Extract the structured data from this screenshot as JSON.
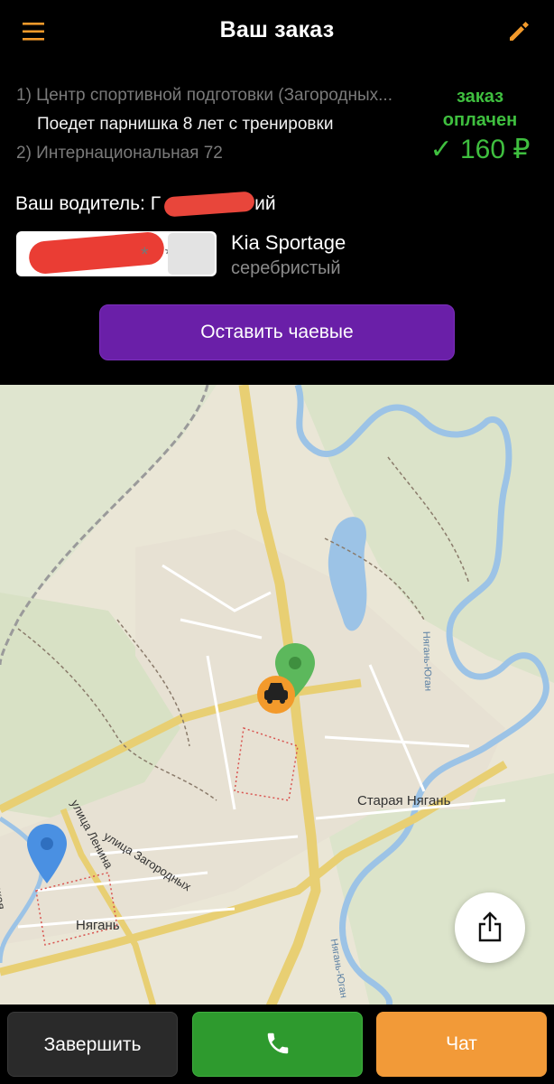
{
  "header": {
    "title": "Ваш заказ",
    "menu_icon": "menu-icon",
    "edit_icon": "pencil-icon",
    "accent_color": "#f39a2b"
  },
  "route": {
    "stop1": "1) Центр спортивной подготовки  (Загородных...",
    "note": "Поедет парнишка 8 лет с тренировки",
    "stop2": "2) Интернациональная 72"
  },
  "payment": {
    "status": "заказ оплачен",
    "price": "✓ 160 ₽",
    "color": "#3fbf3f"
  },
  "driver": {
    "label": "Ваш водитель: Г",
    "name_suffix": "ий",
    "plate_stars": "* *",
    "car_model": "Kia Sportage",
    "car_color": "серебристый"
  },
  "tip_button": "Оставить чаевые",
  "map": {
    "labels": {
      "old_nyagan": "Старая Нягань",
      "nyagan": "Нягань",
      "lenina": "улица Ленина",
      "zagorodnykh": "улица Загородных",
      "river": "Нягань-Юган",
      "river2": "Нягань-Юган",
      "skaya": "ская"
    }
  },
  "share_icon": "share-icon",
  "buttons": {
    "finish": "Завершить",
    "call_icon": "phone-icon",
    "chat": "Чат"
  }
}
